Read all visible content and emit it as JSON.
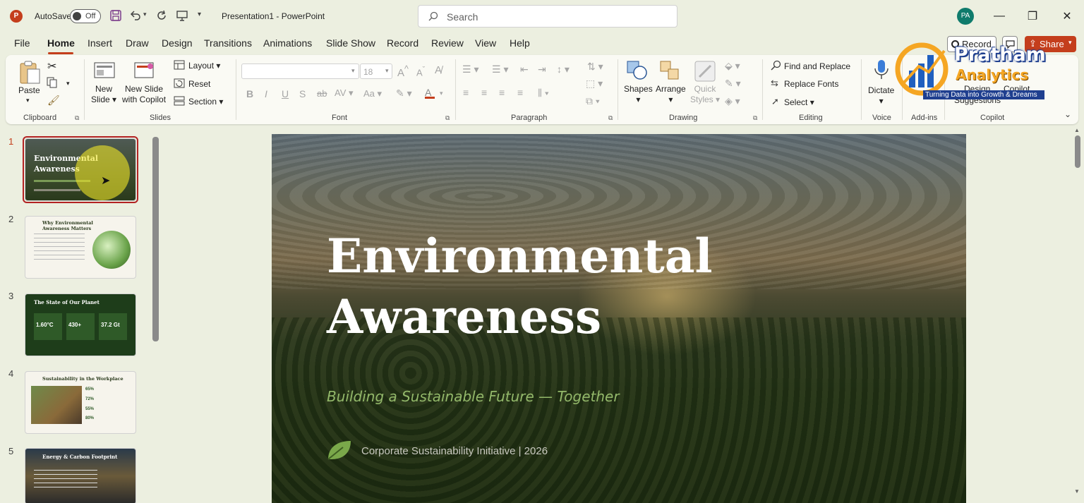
{
  "titlebar": {
    "autosave_label": "AutoSave",
    "autosave_state": "Off",
    "doc_title": "Presentation1  -  PowerPoint",
    "search_placeholder": "Search",
    "user_initials": "PA"
  },
  "menu": {
    "tabs": [
      "File",
      "Home",
      "Insert",
      "Draw",
      "Design",
      "Transitions",
      "Animations",
      "Slide Show",
      "Record",
      "Review",
      "View",
      "Help"
    ],
    "active": "Home",
    "record_button": "Record",
    "share_button": "Share"
  },
  "ribbon": {
    "clipboard": {
      "paste": "Paste",
      "group": "Clipboard"
    },
    "slides": {
      "new_slide": "New\nSlide",
      "new_slide_copilot": "New Slide\nwith Copilot",
      "layout": "Layout",
      "reset": "Reset",
      "section": "Section",
      "group": "Slides"
    },
    "font": {
      "font_size": "18",
      "group": "Font"
    },
    "paragraph": {
      "group": "Paragraph"
    },
    "drawing": {
      "shapes": "Shapes",
      "arrange": "Arrange",
      "quick_styles": "Quick\nStyles",
      "group": "Drawing"
    },
    "editing": {
      "find_replace": "Find and Replace",
      "replace_fonts": "Replace Fonts",
      "select": "Select",
      "group": "Editing"
    },
    "voice": {
      "dictate": "Dictate",
      "group": "Voice"
    },
    "addins": {
      "group": "Add-ins"
    },
    "copilot": {
      "design": "Design",
      "copilot": "Copilot",
      "suggestions": "Suggestions",
      "group": "Copilot"
    }
  },
  "brand_overlay": {
    "name": "Pratham",
    "name2": "Analytics",
    "tagline": "Turning Data into Growth & Dreams"
  },
  "slides_panel": {
    "numbers": [
      "1",
      "2",
      "3",
      "4",
      "5"
    ],
    "thumb_titles": [
      "Environmental Awareness",
      "Why Environmental Awareness Matters",
      "The State of Our Planet",
      "Sustainability in the Workplace",
      "Energy & Carbon Footprint"
    ],
    "thumb3_stats": [
      "1.60°C",
      "430+",
      "37.2 Gt"
    ],
    "thumb4_stats": [
      "65%",
      "72%",
      "55%",
      "80%"
    ]
  },
  "slide": {
    "title_line1": "Environmental",
    "title_line2": "Awareness",
    "subtitle": "Building a Sustainable Future — Together",
    "footer": "Corporate Sustainability Initiative  |  2026"
  },
  "colors": {
    "accent": "#c43e1c",
    "share_bg": "#c43e1c",
    "selected_border": "#b22222",
    "subtitle_green": "#93b86a"
  }
}
